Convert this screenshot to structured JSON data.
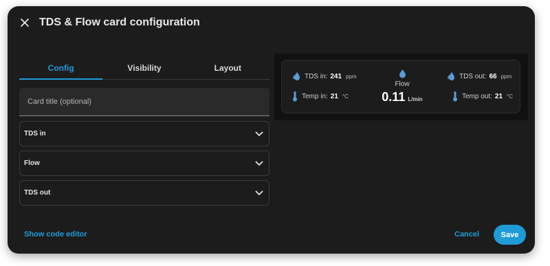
{
  "dialog": {
    "title": "TDS & Flow card configuration",
    "close_icon": "close-icon"
  },
  "tabs": [
    {
      "label": "Config",
      "active": true
    },
    {
      "label": "Visibility",
      "active": false
    },
    {
      "label": "Layout",
      "active": false
    }
  ],
  "card_title_field": {
    "placeholder": "Card title (optional)",
    "value": ""
  },
  "sections": [
    {
      "label": "TDS in",
      "icon": "chevron-down-icon"
    },
    {
      "label": "Flow",
      "icon": "chevron-down-icon"
    },
    {
      "label": "TDS out",
      "icon": "chevron-down-icon"
    }
  ],
  "preview": {
    "tds_in": {
      "label": "TDS in:",
      "value": "241",
      "unit": "ppm",
      "icon": "water-drops-icon"
    },
    "temp_in": {
      "label": "Temp in:",
      "value": "21",
      "unit": "°C",
      "icon": "thermometer-icon"
    },
    "flow": {
      "label": "Flow",
      "value": "0.11",
      "unit": "L/min",
      "icon": "water-drop-icon"
    },
    "tds_out": {
      "label": "TDS out:",
      "value": "66",
      "unit": "ppm",
      "icon": "water-drops-icon"
    },
    "temp_out": {
      "label": "Temp out:",
      "value": "21",
      "unit": "°C",
      "icon": "thermometer-icon"
    }
  },
  "footer": {
    "code_editor_link": "Show code editor",
    "cancel_label": "Cancel",
    "save_label": "Save"
  },
  "colors": {
    "accent": "#1f9bd8",
    "dialog_bg": "#1c1c1c",
    "preview_bg": "#111111",
    "icon_blue": "#5a9bd6"
  }
}
